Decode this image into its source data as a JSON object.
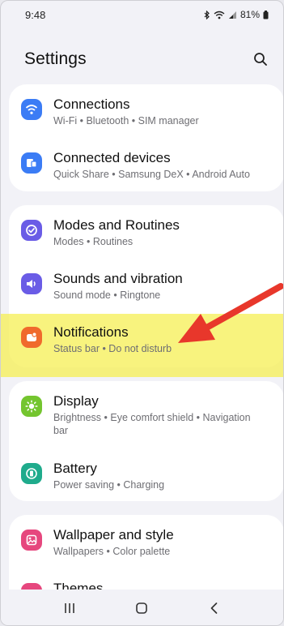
{
  "status": {
    "time": "9:48",
    "battery": "81%"
  },
  "header": {
    "title": "Settings"
  },
  "groups": [
    {
      "items": [
        {
          "title": "Connections",
          "subtitle": "Wi-Fi  •  Bluetooth  •  SIM manager",
          "icon": "wifi-icon",
          "color": "#3b7cf5"
        },
        {
          "title": "Connected devices",
          "subtitle": "Quick Share  •  Samsung DeX  •  Android Auto",
          "icon": "connected-devices-icon",
          "color": "#3b7cf5"
        }
      ]
    },
    {
      "items": [
        {
          "title": "Modes and Routines",
          "subtitle": "Modes  •  Routines",
          "icon": "modes-check-icon",
          "color": "#6a5ce6"
        },
        {
          "title": "Sounds and vibration",
          "subtitle": "Sound mode  •  Ringtone",
          "icon": "speaker-icon",
          "color": "#6a5ce6"
        },
        {
          "title": "Notifications",
          "subtitle": "Status bar  •  Do not disturb",
          "icon": "notification-icon",
          "color": "#f06a2c"
        }
      ]
    },
    {
      "items": [
        {
          "title": "Display",
          "subtitle": "Brightness  •  Eye comfort shield  •  Navigation bar",
          "icon": "sun-icon",
          "color": "#74c52f"
        },
        {
          "title": "Battery",
          "subtitle": "Power saving  •  Charging",
          "icon": "battery-icon",
          "color": "#1fab8c"
        }
      ]
    },
    {
      "items": [
        {
          "title": "Wallpaper and style",
          "subtitle": "Wallpapers  •  Color palette",
          "icon": "wallpaper-icon",
          "color": "#e6477e"
        },
        {
          "title": "Themes",
          "subtitle": "",
          "icon": "themes-icon",
          "color": "#e6477e"
        }
      ]
    }
  ],
  "annotation": {
    "highlight_color": "#f6f05a",
    "arrow_color": "#e8372b"
  },
  "navbar": {
    "buttons": [
      "recents-icon",
      "home-icon",
      "back-icon"
    ]
  }
}
